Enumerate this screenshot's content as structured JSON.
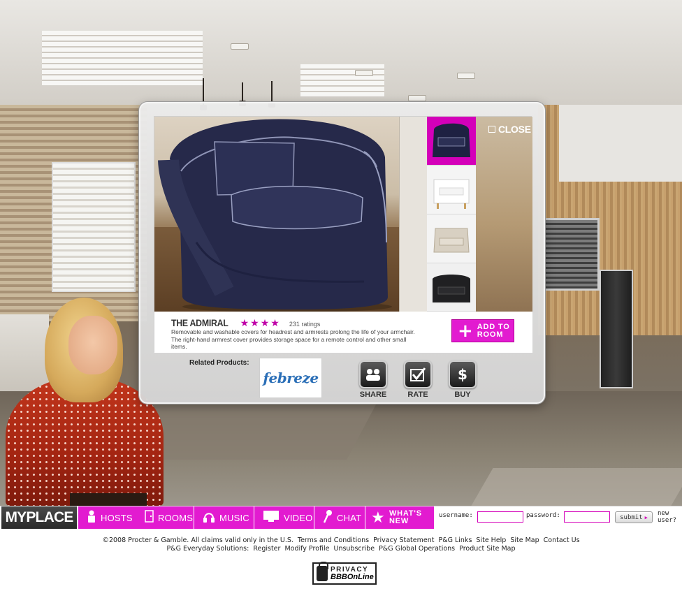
{
  "product": {
    "name": "THE ADMIRAL",
    "stars": "★★★★",
    "rating_value": 4,
    "ratings_label": "231 ratings",
    "description": "Removable and washable covers for headrest and armrests prolong the life of your armchair. The right-hand armrest cover provides storage space for a remote control and other small items.",
    "add_to_room_label": "ADD TO\nROOM",
    "close_label": "CLOSE",
    "thumbnails": [
      "navy-armchair",
      "white-armchair",
      "beige-armchair",
      "black-armchair"
    ],
    "selected_thumbnail": "navy-armchair"
  },
  "related": {
    "label": "Related Products:",
    "brand": "febreze"
  },
  "actions": [
    {
      "label": "SHARE",
      "icon": "share-icon"
    },
    {
      "label": "RATE",
      "icon": "rate-icon"
    },
    {
      "label": "BUY",
      "icon": "buy-icon"
    }
  ],
  "nav": {
    "brand": "MYPLACE",
    "items": [
      {
        "label": "HOSTS",
        "icon": "person-icon"
      },
      {
        "label": "ROOMS",
        "icon": "door-icon"
      },
      {
        "label": "MUSIC",
        "icon": "headphones-icon"
      },
      {
        "label": "VIDEO",
        "icon": "monitor-icon"
      },
      {
        "label": "CHAT",
        "icon": "microphone-icon"
      }
    ],
    "whats_new": "WHAT'S\nNEW"
  },
  "login": {
    "username_label": "username:",
    "password_label": "password:",
    "username_value": "",
    "password_value": "",
    "submit_label": "submit",
    "new_user_label": "new\nuser?"
  },
  "footer": {
    "copyright": "©2008 Procter & Gamble. All claims valid only in the U.S.",
    "row1_links": [
      "Terms and Conditions",
      "Privacy Statement",
      "P&G Links",
      "Site Help",
      "Site Map",
      "Contact Us"
    ],
    "row2_label": "P&G Everyday Solutions:",
    "row2_links": [
      "Register",
      "Modify Profile",
      "Unsubscribe",
      "P&G Global Operations",
      "Product Site Map"
    ]
  },
  "seal": {
    "line1": "PRIVACY",
    "line2": "BBBOnLine"
  },
  "colors": {
    "accent": "#e21bd0",
    "nav_dark": "#2f2f2f",
    "chair": "#252a4a"
  }
}
